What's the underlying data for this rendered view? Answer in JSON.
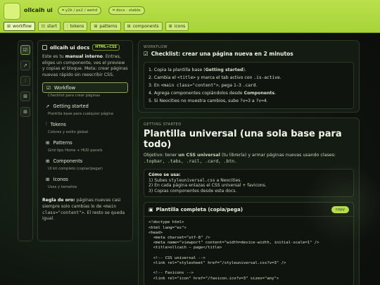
{
  "header": {
    "brand": "ollcaih ui",
    "pill_path": "y2k / ps2 / weird",
    "pill_docs": "docs · stable"
  },
  "tabs": [
    {
      "label": "workflow",
      "icon": "grid-icon",
      "active": true
    },
    {
      "label": "start",
      "icon": "square-icon"
    },
    {
      "label": "tokens",
      "icon": "sliders-icon"
    },
    {
      "label": "patterns",
      "icon": "grid-icon"
    },
    {
      "label": "components",
      "icon": "grid-icon"
    },
    {
      "label": "icons",
      "icon": "grid-icon"
    }
  ],
  "rail": [
    "check-icon",
    "rocket-icon",
    "sliders-icon",
    "grid-icon",
    "grid-icon"
  ],
  "side": {
    "title": "ollcaih ui docs",
    "badge": "HTML+CSS",
    "desc_pre": "Este es tu ",
    "desc_bold": "manual interno",
    "desc_post": ". Entras, eliges un componente, ves el preview y copias el bloque. Meta: crear páginas nuevas rápido sin reescribir CSS.",
    "nav": [
      {
        "label": "Workflow",
        "sub": "Checklist para crear páginas",
        "icon": "check-icon",
        "active": true
      },
      {
        "label": "Getting started",
        "sub": "Plantilla base para cualquier página",
        "icon": "rocket-icon"
      },
      {
        "label": "Tokens",
        "sub": "Colores y estilo global",
        "icon": "sliders-icon"
      },
      {
        "label": "Patterns",
        "sub": "Grid tipo Home + HUD panels",
        "icon": "grid-icon"
      },
      {
        "label": "Components",
        "sub": "UI kit completo (copiar/pegar)",
        "icon": "grid-icon"
      },
      {
        "label": "Iconos",
        "sub": "Usos y tamaños",
        "icon": "grid-icon"
      }
    ],
    "rule_bold": "Regla de oro:",
    "rule_a": " páginas nuevas casi siempre solo cambias lo de ",
    "rule_code": "<main class=\"content\">",
    "rule_b": ". El resto se queda igual."
  },
  "workflow": {
    "kicker": "WORKFLOW",
    "title": "Checklist: crear una página nueva en 2 minutos",
    "steps": [
      {
        "pre": "1. Copia la plantilla base (",
        "bold": "Getting started",
        "post": ")."
      },
      {
        "pre": "2. Cambia el ",
        "code": "<title>",
        "mid": " y marca el tab activo con ",
        "code2": ".is-active",
        "post": "."
      },
      {
        "pre": "3. En ",
        "code": "<main class=\"content\">",
        "mid": ", pega 1–3 ",
        "code2": ".card",
        "post": "."
      },
      {
        "pre": "4. Agrega componentes copiándolos desde ",
        "bold": "Components",
        "post": "."
      },
      {
        "pre": "5. Si Neocities no muestra cambios, sube ",
        "code": "?v=3",
        "mid": " a ",
        "code2": "?v=4",
        "post": "."
      }
    ]
  },
  "getting": {
    "kicker": "GETTING STARTED",
    "title": "Plantilla universal (una sola base para todo)",
    "lead_pre": "Objetivo: tener ",
    "lead_bold": "un CSS universal",
    "lead_post": " (tu librería) y armar páginas nuevas usando clases: ",
    "lead_classes": ".topbar, .tabs, .rail, .card, .btn.",
    "how_title": "Cómo se usa:",
    "how_1_pre": "1) Subes ",
    "how_1_code": "styleuniversal.css",
    "how_1_post": " a Neocities.",
    "how_2": "2) En cada página enlazas el CSS universal + favicons.",
    "how_3": "3) Copias componentes desde esta docs.",
    "code_title": "Plantilla completa (copia/pega)",
    "copy_label": "copy",
    "code": "<!doctype html>\n<html lang=\"es\">\n<head>\n  <meta charset=\"utf-8\" />\n  <meta name=\"viewport\" content=\"width=device-width, initial-scale=1\" />\n  <title>ollcaih — page</title>\n\n  <!-- CSS universal -->\n  <link rel=\"stylesheet\" href=\"/styleuniversal.css?v=3\" />\n\n  <!-- Favicons -->\n  <link rel=\"icon\" href=\"/favicon.ico?v=3\" sizes=\"any\">"
  }
}
